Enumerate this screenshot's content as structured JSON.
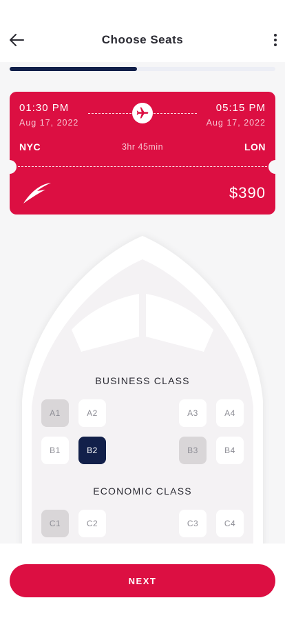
{
  "header": {
    "title": "Choose Seats",
    "progress": 0.48
  },
  "ticket": {
    "departure_time": "01:30 PM",
    "departure_date": "Aug 17, 2022",
    "arrival_time": "05:15 PM",
    "arrival_date": "Aug 17, 2022",
    "origin": "NYC",
    "destination": "LON",
    "duration": "3hr 45min",
    "price": "$390",
    "color": "#dc0f42"
  },
  "business_class": {
    "label": "BUSINESS CLASS",
    "seats": [
      {
        "id": "A1",
        "state": "taken"
      },
      {
        "id": "A2",
        "state": "available"
      },
      {
        "id": "A3",
        "state": "available"
      },
      {
        "id": "A4",
        "state": "available"
      },
      {
        "id": "B1",
        "state": "available"
      },
      {
        "id": "B2",
        "state": "selected"
      },
      {
        "id": "B3",
        "state": "taken"
      },
      {
        "id": "B4",
        "state": "available"
      }
    ]
  },
  "economic_class": {
    "label": "ECONOMIC CLASS",
    "seats": [
      {
        "id": "C1",
        "state": "taken"
      },
      {
        "id": "C2",
        "state": "available"
      },
      {
        "id": "C3",
        "state": "available"
      },
      {
        "id": "C4",
        "state": "available"
      }
    ]
  },
  "footer": {
    "next_label": "NEXT"
  },
  "icons": {
    "back": "arrow-left-icon",
    "more": "more-vertical-icon",
    "flight": "airplane-icon",
    "logo": "airline-logo"
  },
  "colors": {
    "accent": "#dc0f42",
    "selected": "#12204a",
    "taken": "#d9d6d8"
  }
}
